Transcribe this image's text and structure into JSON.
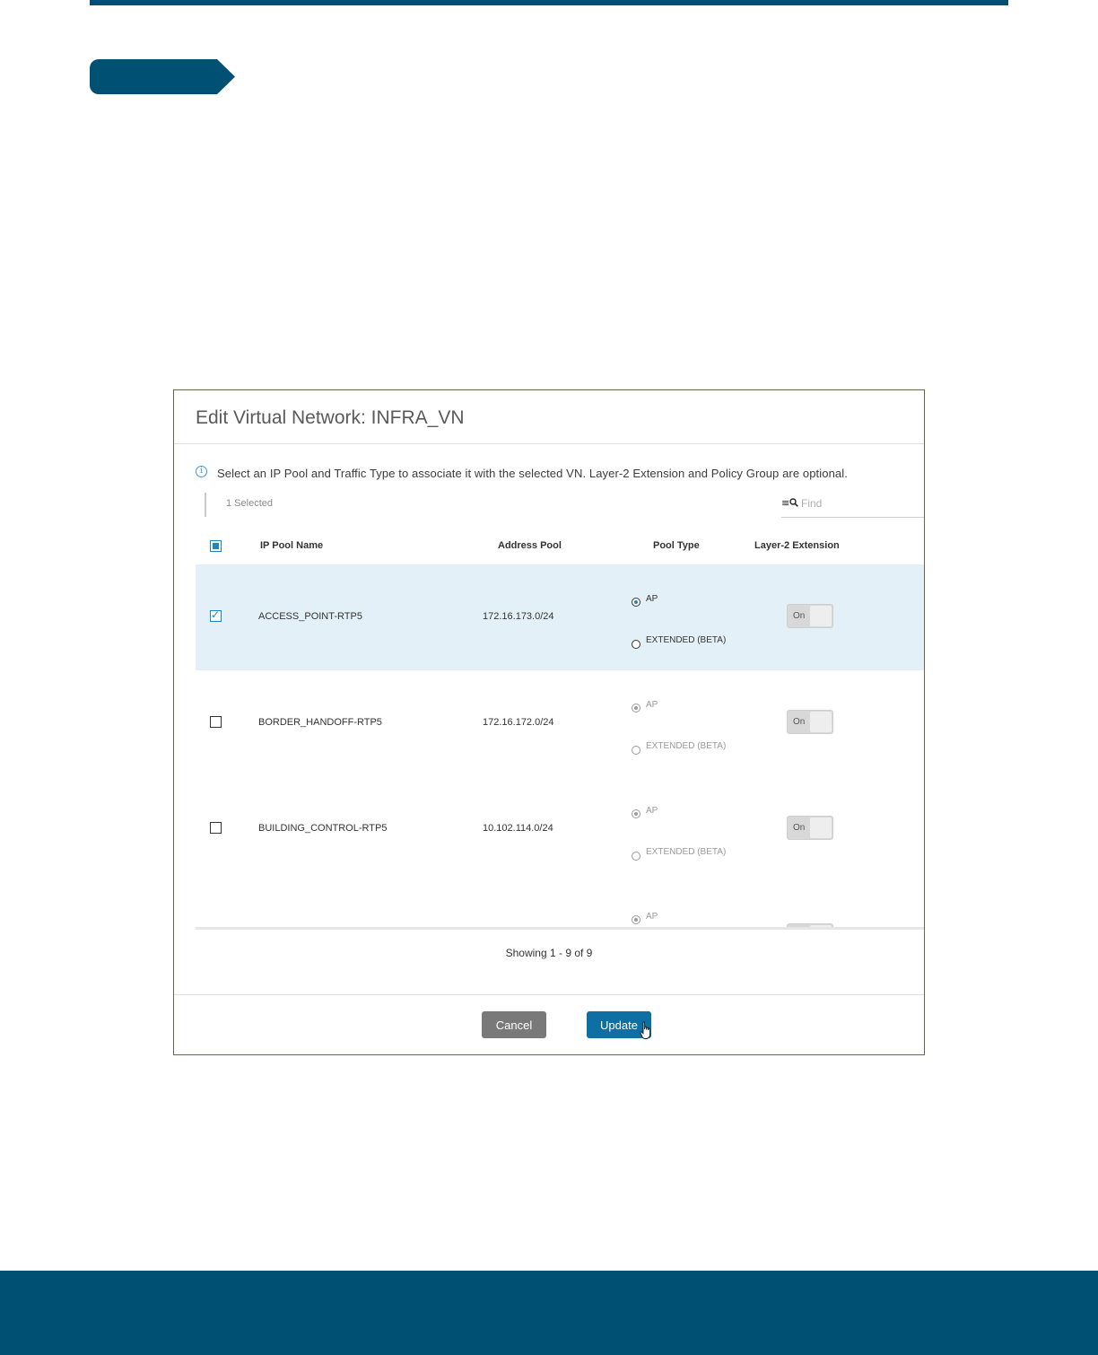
{
  "colors": {
    "brand": "#005073",
    "accent": "#1a86c7",
    "selected_row": "#e3f0f8"
  },
  "dialog": {
    "title": "Edit Virtual Network: INFRA_VN",
    "info_icon": "info-icon",
    "info": "Select an IP Pool and Traffic Type to associate it with the selected VN. Layer-2 Extension and Policy Group are optional.",
    "selected_count": "1 Selected",
    "search": {
      "icon": "filter-search-icon",
      "placeholder": "Find"
    },
    "table": {
      "headers": {
        "select_all_state": "indeterminate",
        "ip_pool_name": "IP Pool Name",
        "address_pool": "Address Pool",
        "pool_type": "Pool Type",
        "layer2_extension": "Layer-2 Extension"
      },
      "rows": [
        {
          "selected": true,
          "name": "ACCESS_POINT-RTP5",
          "address": "172.16.173.0/24",
          "ap": "AP",
          "extended": "EXTENDED (BETA)",
          "pool_type": "AP",
          "toggle": "On"
        },
        {
          "selected": false,
          "name": "BORDER_HANDOFF-RTP5",
          "address": "172.16.172.0/24",
          "ap": "AP",
          "extended": "EXTENDED (BETA)",
          "pool_type": "AP",
          "toggle": "On"
        },
        {
          "selected": false,
          "name": "BUILDING_CONTROL-RTP5",
          "address": "10.102.114.0/24",
          "ap": "AP",
          "extended": "EXTENDED (BETA)",
          "pool_type": "AP",
          "toggle": "On"
        },
        {
          "ap": "AP"
        }
      ]
    },
    "pagination": "Showing 1 - 9 of 9",
    "buttons": {
      "cancel": "Cancel",
      "update": "Update"
    },
    "cursor_icon": "hand-pointer-icon"
  }
}
